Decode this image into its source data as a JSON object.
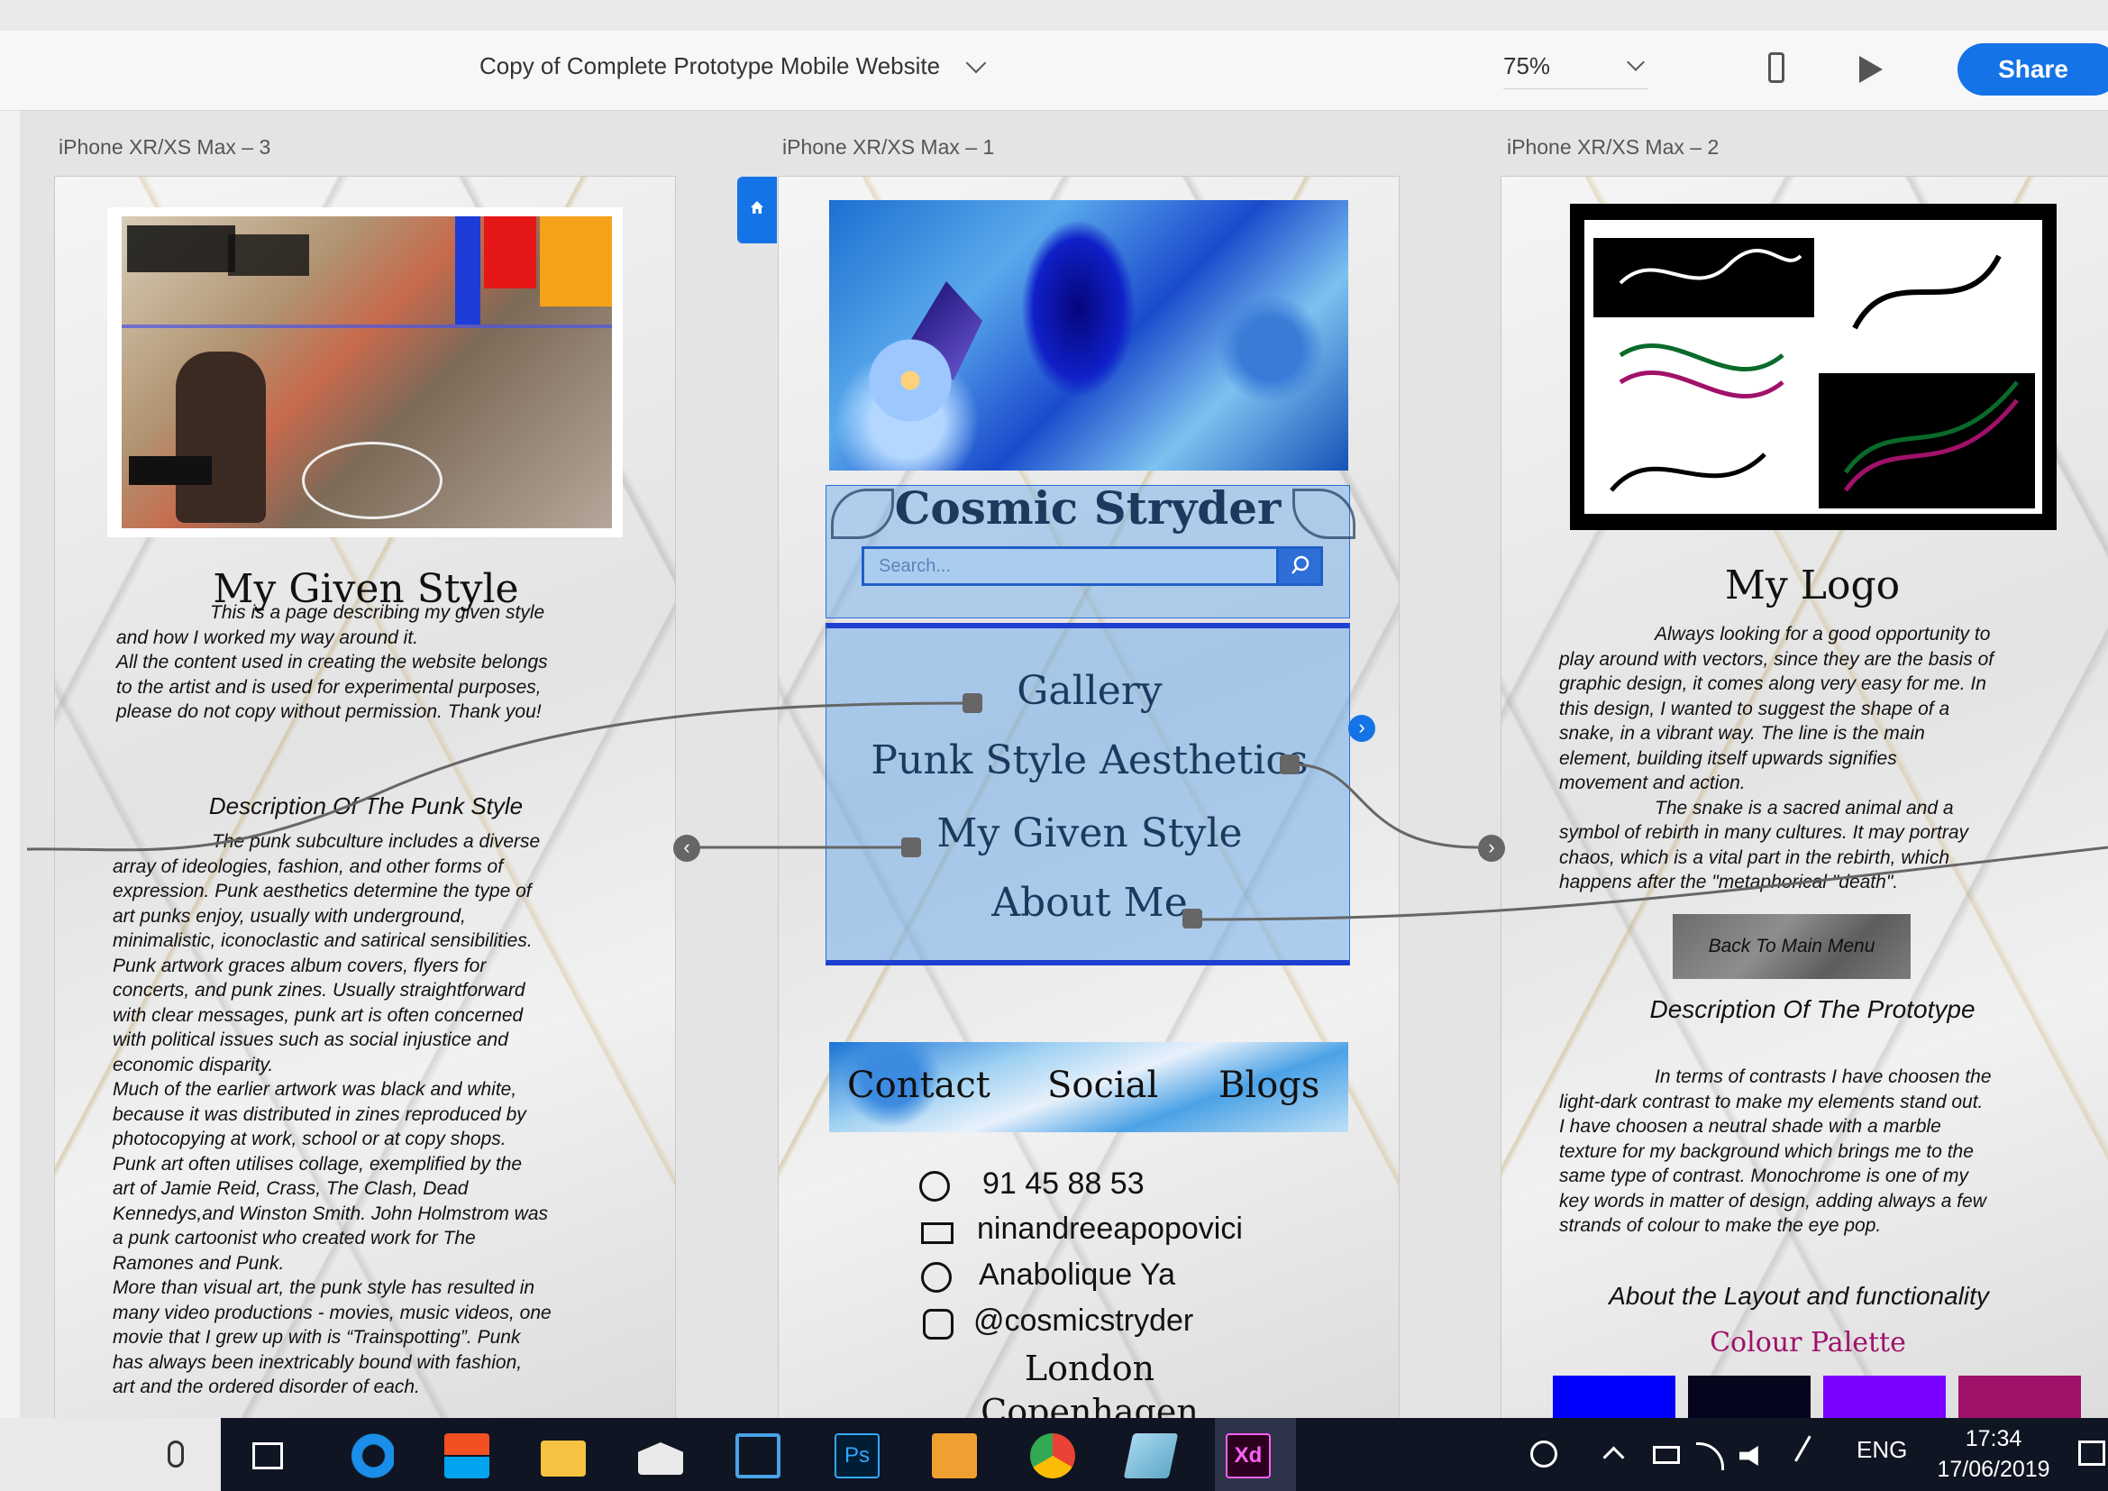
{
  "toolbar": {
    "document_title": "Copy of Complete Prototype Mobile Website",
    "zoom": "75%",
    "share_label": "Share",
    "icons": [
      "chevron-down-icon",
      "mobile-device-icon",
      "play-icon"
    ]
  },
  "artboards": {
    "left_label": "iPhone XR/XS Max – 3",
    "middle_label": "iPhone XR/XS Max – 1",
    "right_label": "iPhone XR/XS Max – 2"
  },
  "given_style_page": {
    "title": "My Given Style",
    "intro_lines": [
      "This is a page describing my given style",
      "and how I worked my way around it.",
      "All the content used in creating the website belongs",
      "to the artist and is used for experimental purposes,",
      "please do not copy without permission. Thank you!"
    ],
    "desc_heading": "Description Of The Punk Style",
    "desc_lines": [
      "The punk subculture includes a diverse",
      "array of ideologies, fashion, and other forms of",
      "expression. Punk aesthetics determine the type of",
      "art punks enjoy, usually with underground,",
      "minimalistic, iconoclastic and satirical sensibilities.",
      "Punk artwork graces album covers, flyers for",
      "concerts, and punk zines. Usually straightforward",
      "with clear messages, punk art is often concerned",
      "with political issues such as social injustice and",
      "economic disparity.",
      "Much of the earlier artwork was black and white,",
      "because it was distributed in zines reproduced by",
      "photocopying at work, school or at copy shops.",
      "Punk art often utilises collage, exemplified by the",
      "art of Jamie Reid, Crass, The Clash, Dead",
      "Kennedys,and Winston Smith. John Holmstrom was",
      "a punk cartoonist who created work for The",
      "Ramones and Punk.",
      "More than visual art, the punk style has resulted in",
      "many video productions - movies, music videos, one",
      "movie that I grew up with is “Trainspotting”. Punk",
      "has always been inextricably bound with fashion,",
      "art and the ordered disorder of each."
    ]
  },
  "home_page": {
    "site_title": "Cosmic Stryder",
    "search_placeholder": "Search...",
    "nav": [
      "Gallery",
      "Punk Style Aesthetics",
      "My Given Style",
      "About Me"
    ],
    "footer_links": [
      "Contact",
      "Social",
      "Blogs"
    ],
    "contacts": [
      {
        "icon": "phone-icon",
        "text": "91 45 88 53"
      },
      {
        "icon": "mail-icon",
        "text": "ninandreeapopovici"
      },
      {
        "icon": "facebook-icon",
        "text": "Anabolique Ya"
      },
      {
        "icon": "instagram-icon",
        "text": "@cosmicstryder"
      }
    ],
    "cities": [
      "London",
      "Copenhagen"
    ]
  },
  "logo_page": {
    "title": "My Logo",
    "body_lines": [
      "Always looking for a good opportunity to",
      "play around with vectors, since they are the basis of",
      "graphic design, it comes along very easy for me. In",
      "this design, I wanted to suggest the shape of a",
      "snake, in a vibrant way. The line is the main",
      "element, building itself upwards signifies",
      "movement and action.",
      "The snake is a sacred animal and a",
      "symbol of rebirth in many cultures. It may portray",
      "chaos, which is a vital part in the rebirth, which",
      "happens after the \"metaphorical \"death\"."
    ],
    "back_button": "Back To Main Menu",
    "proto_heading": "Description Of The Prototype",
    "proto_lines": [
      "In terms of contrasts I have choosen the",
      "light-dark contrast to make my elements stand out.",
      "I have choosen a neutral shade with a marble",
      "texture for my background which brings me to the",
      "same type of contrast. Monochrome is one of my",
      "key words in matter of design, adding always a few",
      "strands of colour to make the eye pop."
    ],
    "layout_heading": "About the Layout and functionality",
    "palette_heading": "Colour Palette",
    "palette": [
      "#0000ff",
      "#05051e",
      "#7a00ff",
      "#a0116a"
    ]
  },
  "taskbar": {
    "language": "ENG",
    "time": "17:34",
    "date": "17/06/2019",
    "apps": [
      "microphone-icon",
      "task-view-icon",
      "edge-icon",
      "store-icon",
      "file-explorer-icon",
      "mail-icon",
      "app-icon",
      "photoshop-icon",
      "video-icon",
      "chrome-icon",
      "tablet-icon",
      "xd-icon"
    ],
    "xd_label": "Xd",
    "ps_label": "Ps"
  },
  "colors": {
    "accent": "#1473e6",
    "taskbar": "#101523",
    "nav_text": "#1b3a5e"
  }
}
